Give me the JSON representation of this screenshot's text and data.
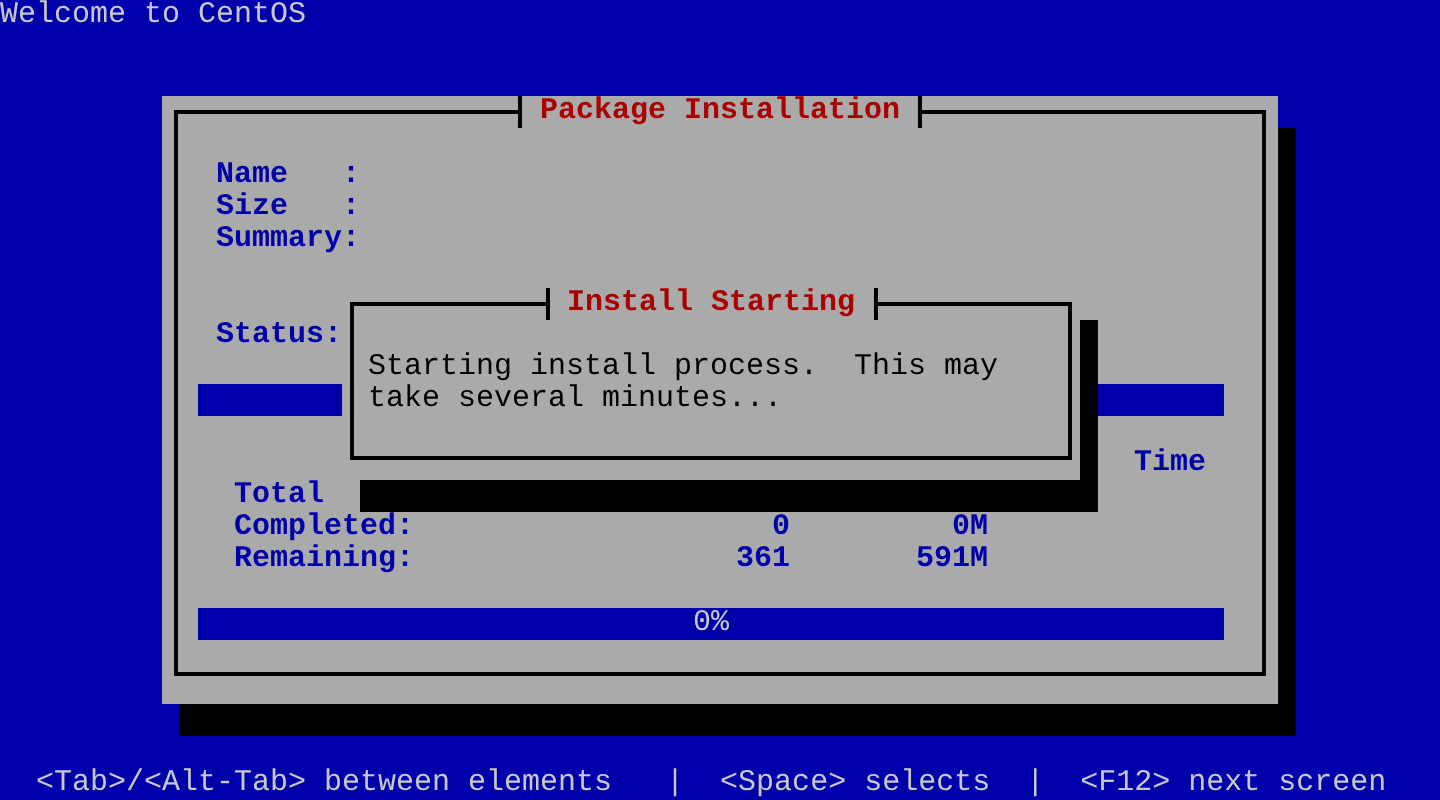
{
  "header": {
    "title": "Welcome to CentOS"
  },
  "package_installation": {
    "title": "Package Installation",
    "fields": [
      {
        "label": "Name   :"
      },
      {
        "label": "Size   :"
      },
      {
        "label": "Summary:"
      }
    ],
    "status_label": "Status:",
    "package_progress": {
      "level": 0
    },
    "totals": {
      "time_heading": "Time",
      "rows": [
        {
          "label": "Total"
        },
        {
          "label": "Completed:",
          "column_2": "0",
          "column_3": "0M"
        },
        {
          "label": "Remaining:",
          "column_2": "361",
          "column_3": "591M"
        }
      ]
    },
    "overall_progress": {
      "level": 0,
      "reading": "0%"
    }
  },
  "dialog": {
    "title": "Install Starting",
    "message": "Starting install process.  This may take several minutes..."
  },
  "footer": {
    "hints": "<Tab>/<Alt-Tab> between elements   |  <Space> selects  |  <F12> next screen"
  }
}
